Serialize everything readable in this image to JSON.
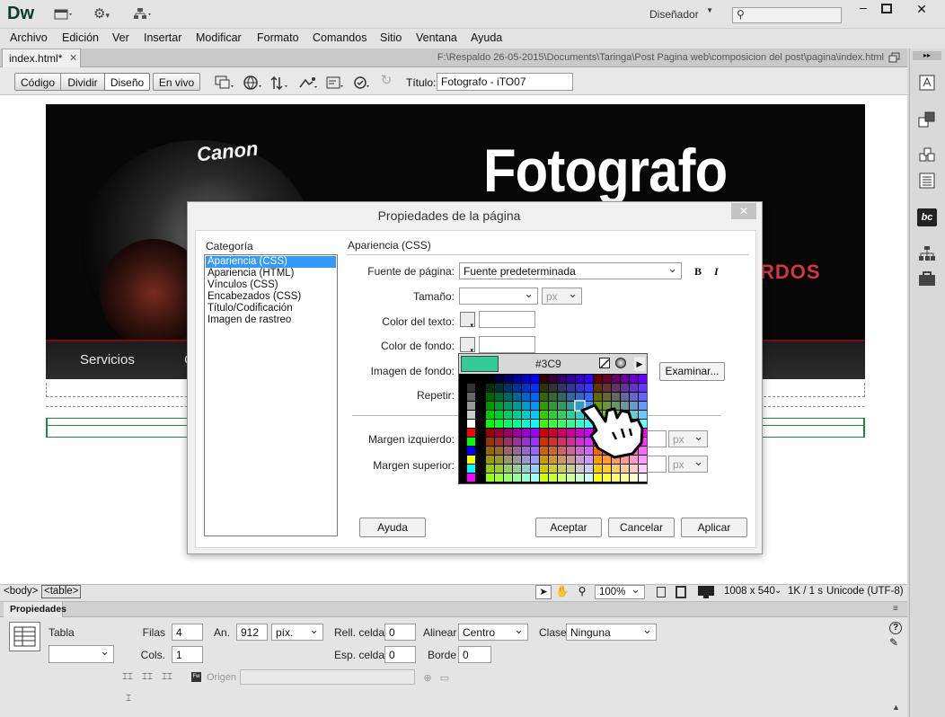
{
  "app": {
    "logo": "Dw",
    "workspace": "Diseñador",
    "search_placeholder": ""
  },
  "menu": [
    "Archivo",
    "Edición",
    "Ver",
    "Insertar",
    "Modificar",
    "Formato",
    "Comandos",
    "Sitio",
    "Ventana",
    "Ayuda"
  ],
  "tab": {
    "name": "index.html*",
    "path": "F:\\Respaldo 26-05-2015\\Documents\\Taringa\\Post Pagina web\\composicion del post\\pagina\\index.html"
  },
  "toolbar": {
    "views": [
      "Código",
      "Dividir",
      "Diseño",
      "En vivo"
    ],
    "title_label": "Título:",
    "title_value": "Fotografo - iTO07"
  },
  "canvas": {
    "banner_logo": "Canon",
    "banner_title": "Fotografo",
    "banner_partial": "RDOS",
    "nav_item": "Servicios",
    "nav_partial": "C"
  },
  "dialog": {
    "title": "Propiedades de la página",
    "category_label": "Categoría",
    "categories": [
      "Apariencia (CSS)",
      "Apariencia (HTML)",
      "Vínculos (CSS)",
      "Encabezados (CSS)",
      "Título/Codificación",
      "Imagen de rastreo"
    ],
    "section": "Apariencia (CSS)",
    "font_label": "Fuente de página:",
    "font_value": "Fuente predeterminada",
    "bold": "B",
    "italic": "I",
    "size_label": "Tamaño:",
    "unit": "px",
    "text_color_label": "Color del texto:",
    "bg_color_label": "Color de fondo:",
    "bg_image_label": "Imagen de fondo:",
    "browse": "Examinar...",
    "repeat_label": "Repetir:",
    "left_margin_label": "Margen izquierdo:",
    "top_margin_label": "Margen superior:",
    "buttons": {
      "help": "Ayuda",
      "accept": "Aceptar",
      "cancel": "Cancelar",
      "apply": "Aplicar"
    },
    "picker_hex": "#3C9",
    "picker_color": "#33CC99"
  },
  "status": {
    "tags": [
      "<body>",
      "<table>"
    ],
    "zoom": "100%",
    "size": "1008 x 540",
    "speed": "1K / 1 s",
    "encoding": "Unicode (UTF-8)"
  },
  "props": {
    "title": "Propiedades",
    "type": "Tabla",
    "rows_label": "Filas",
    "rows": "4",
    "cols_label": "Cols.",
    "cols": "1",
    "width_label": "An.",
    "width": "912",
    "width_unit": "píx.",
    "cellpad_label": "Rell. celda",
    "cellpad": "0",
    "cellspace_label": "Esp. celda",
    "cellspace": "0",
    "align_label": "Alinear",
    "align": "Centro",
    "border_label": "Borde",
    "border": "0",
    "class_label": "Clase",
    "class": "Ninguna",
    "origin_label": "Origen"
  }
}
